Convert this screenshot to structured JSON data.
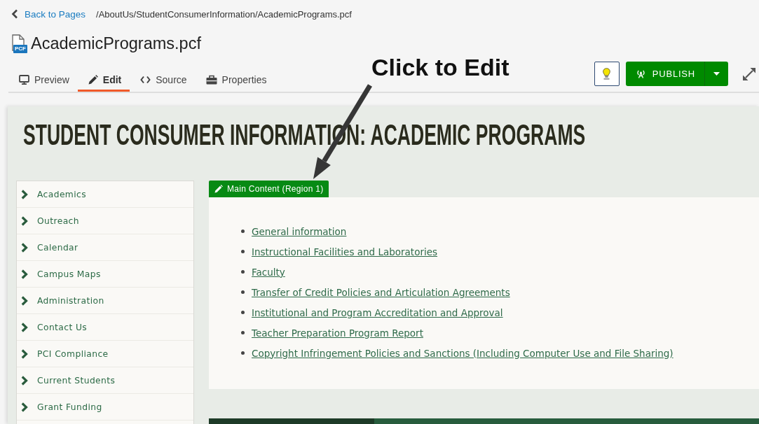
{
  "breadcrumb": {
    "back_link": "Back to Pages",
    "path": "/AboutUs/StudentConsumerInformation/AcademicPrograms.pcf"
  },
  "file": {
    "name": "AcademicPrograms.pcf",
    "type_badge": "PCF"
  },
  "tabs": [
    {
      "kind": "preview",
      "label": "Preview",
      "selected": false
    },
    {
      "kind": "edit",
      "label": "Edit",
      "selected": true
    },
    {
      "kind": "source",
      "label": "Source",
      "selected": false
    },
    {
      "kind": "properties",
      "label": "Properties",
      "selected": false
    }
  ],
  "toolbar": {
    "publish_button": "PUBLISH"
  },
  "annotation": {
    "text": "Click to Edit"
  },
  "page": {
    "heading": "STUDENT CONSUMER INFORMATION: ACADEMIC PROGRAMS",
    "sidebar": {
      "items": [
        "Academics",
        "Outreach",
        "Calendar",
        "Campus Maps",
        "Administration",
        "Contact Us",
        "PCI Compliance",
        "Current Students",
        "Grant Funding"
      ]
    },
    "region_button": "Main Content (Region 1)",
    "links": [
      "General information",
      "Instructional Facilities and Laboratories",
      "Faculty",
      "Transfer of Credit Policies and Articulation Agreements",
      "Institutional and Program Accreditation and Approval",
      "Teacher Preparation Program Report",
      "Copyright Infringement Policies and Sanctions (Including Computer Use and File Sharing)"
    ]
  }
}
